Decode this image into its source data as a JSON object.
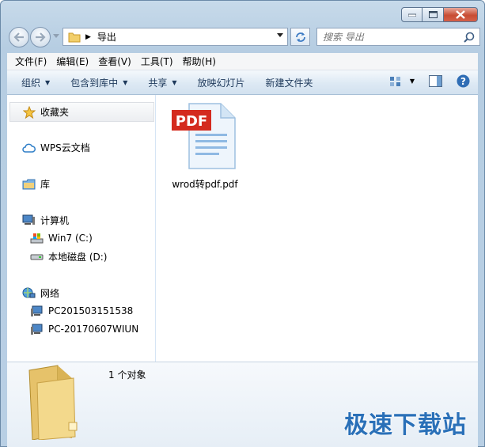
{
  "window": {
    "title_buttons": [
      "minimize",
      "maximize",
      "close"
    ]
  },
  "address_bar": {
    "path": "导出"
  },
  "search": {
    "placeholder": "搜索 导出"
  },
  "menu": [
    "文件(F)",
    "编辑(E)",
    "查看(V)",
    "工具(T)",
    "帮助(H)"
  ],
  "toolbar": {
    "organize": "组织",
    "include_in_library": "包含到库中",
    "share": "共享",
    "slideshow": "放映幻灯片",
    "new_folder": "新建文件夹"
  },
  "nav_pane": {
    "favorites": "收藏夹",
    "wps_cloud": "WPS云文档",
    "libraries": "库",
    "computer": "计算机",
    "drive_c": "Win7 (C:)",
    "drive_d": "本地磁盘 (D:)",
    "network": "网络",
    "pc1": "PC201503151538",
    "pc2": "PC-20170607WIUN"
  },
  "files": [
    {
      "name": "wrod转pdf.pdf",
      "icon": "pdf-file-icon",
      "badge": "PDF"
    }
  ],
  "details": {
    "count_text": "1 个对象"
  },
  "watermark": "极速下载站",
  "colors": {
    "pdf_red": "#d42a1e",
    "accent": "#2a70b8"
  }
}
